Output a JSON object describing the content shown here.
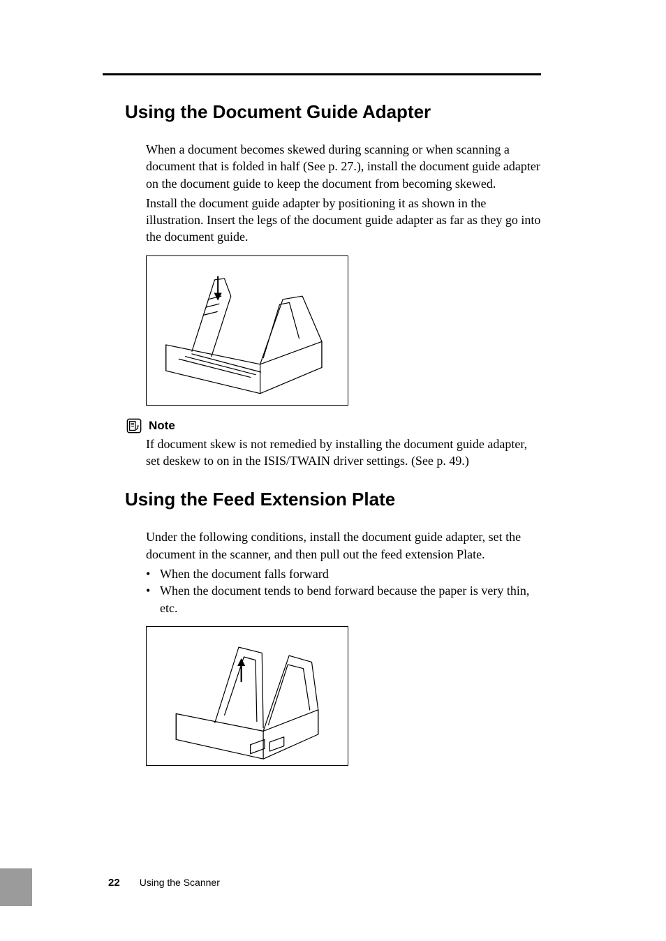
{
  "section1": {
    "heading": "Using the Document Guide Adapter",
    "para1": "When a document becomes skewed during scanning or when scanning a document that is folded in half (See p. 27.), install the document guide adapter on the document guide to keep the document from becoming skewed.",
    "para2": "Install the document guide adapter by positioning it as shown in the illustration. Insert the legs of the document guide adapter as far as they go into the document guide.",
    "note_label": "Note",
    "note_body": "If document skew is not remedied by installing the document guide adapter, set deskew to on in the ISIS/TWAIN driver settings. (See p. 49.)"
  },
  "section2": {
    "heading": "Using the Feed Extension Plate",
    "intro": "Under the following conditions, install the document guide adapter, set the document in the scanner, and then pull out the feed extension Plate.",
    "bullets": [
      "When the document falls forward",
      "When the document tends to bend forward because the paper is very thin, etc."
    ]
  },
  "footer": {
    "page_number": "22",
    "section_title": "Using the Scanner"
  }
}
